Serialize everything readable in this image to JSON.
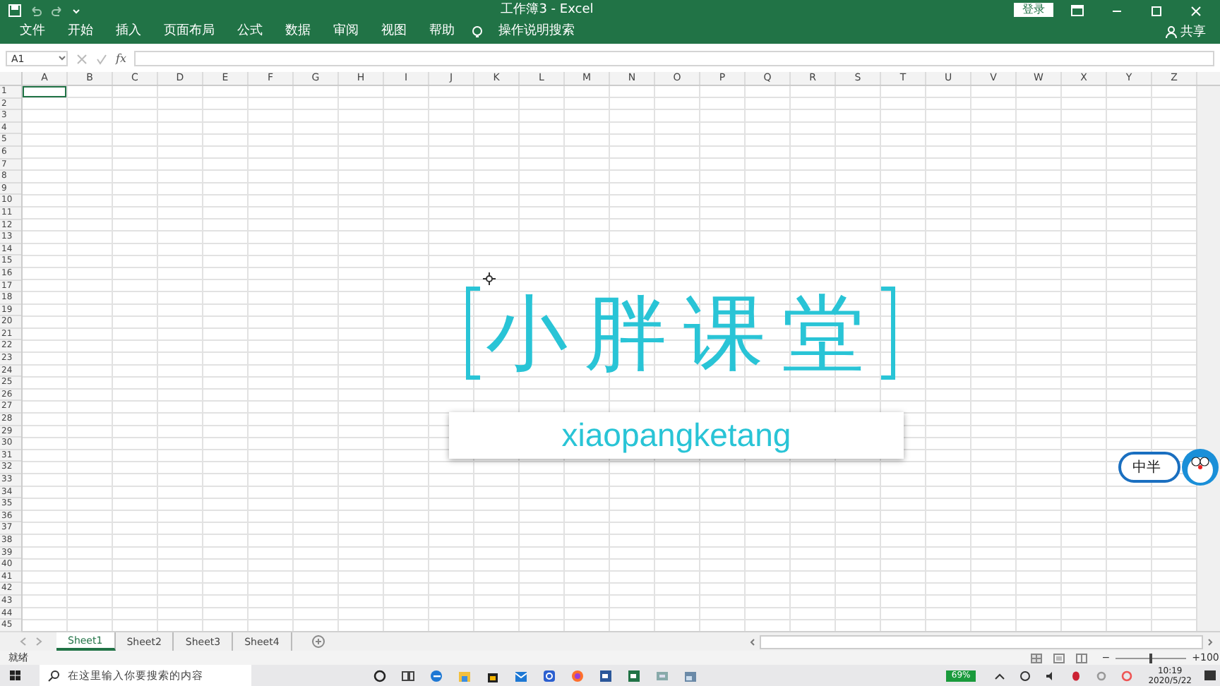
{
  "window": {
    "title": "工作簿3 - Excel",
    "sign_in": "登录",
    "share": "共享"
  },
  "ribbon_tabs": [
    "文件",
    "开始",
    "插入",
    "页面布局",
    "公式",
    "数据",
    "审阅",
    "视图",
    "帮助"
  ],
  "tell_me": "操作说明搜索",
  "formula_bar": {
    "name_box": "A1",
    "function_label": "fx"
  },
  "columns": [
    "A",
    "B",
    "C",
    "D",
    "E",
    "F",
    "G",
    "H",
    "I",
    "J",
    "K",
    "L",
    "M",
    "N",
    "O",
    "P",
    "Q",
    "R",
    "S",
    "T",
    "U",
    "V",
    "W",
    "X",
    "Y",
    "Z"
  ],
  "rows": [
    "1",
    "2",
    "3",
    "4",
    "5",
    "6",
    "7",
    "8",
    "9",
    "10",
    "11",
    "12",
    "13",
    "14",
    "15",
    "16",
    "17",
    "18",
    "19",
    "20",
    "21",
    "22",
    "23",
    "24",
    "25",
    "26",
    "27",
    "28",
    "29",
    "30",
    "31",
    "32",
    "33",
    "34",
    "35",
    "36",
    "37",
    "38",
    "39",
    "40",
    "41",
    "42",
    "43",
    "44",
    "45"
  ],
  "logo": {
    "title": "小胖课堂",
    "subtitle": "xiaopangketang"
  },
  "ime_widget": {
    "label": "中半"
  },
  "sheets": [
    {
      "label": "Sheet1",
      "selected": true
    },
    {
      "label": "Sheet2",
      "selected": false
    },
    {
      "label": "Sheet3",
      "selected": false
    },
    {
      "label": "Sheet4",
      "selected": false
    }
  ],
  "status_bar": {
    "status": "就绪",
    "zoom": {
      "zoom_out": "−",
      "level": 0.5,
      "zoom_in": "+",
      "reading": "100"
    }
  },
  "taskbar": {
    "search_placeholder": "在这里输入你要搜索的内容",
    "meter": "69%",
    "time": "10:19",
    "date": "2020/5/22"
  }
}
